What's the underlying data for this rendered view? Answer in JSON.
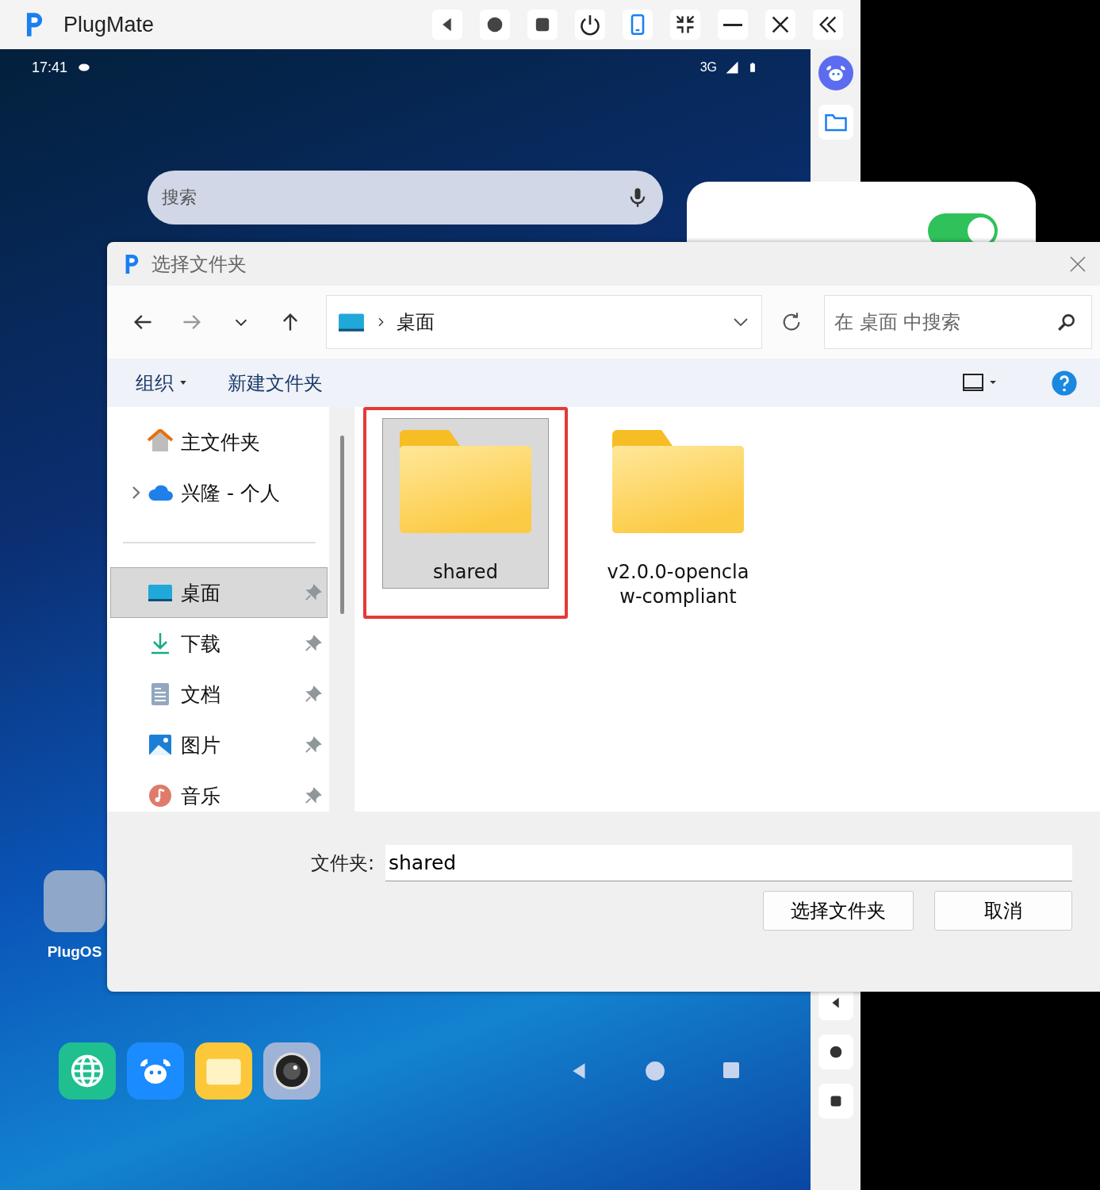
{
  "app": {
    "title": "PlugMate"
  },
  "device": {
    "status_bar": {
      "time": "17:41",
      "network": "3G"
    },
    "search": {
      "placeholder": "搜索"
    },
    "folder": {
      "label": "PlugOS"
    },
    "toggle": {
      "on": true
    }
  },
  "dialog": {
    "title": "选择文件夹",
    "address": {
      "path": "桌面"
    },
    "search": {
      "placeholder": "在 桌面 中搜索"
    },
    "toolbar": {
      "organize": "组织",
      "new_folder": "新建文件夹"
    },
    "sidebar": {
      "items": [
        {
          "label": "主文件夹",
          "kind": "place",
          "selected": false
        },
        {
          "label": "兴隆 - 个人",
          "kind": "tree",
          "expanded": false,
          "selected": false
        },
        {
          "label": "桌面",
          "kind": "pinned",
          "selected": true
        },
        {
          "label": "下载",
          "kind": "pinned",
          "selected": false
        },
        {
          "label": "文档",
          "kind": "pinned",
          "selected": false
        },
        {
          "label": "图片",
          "kind": "pinned",
          "selected": false
        },
        {
          "label": "音乐",
          "kind": "pinned",
          "selected": false
        }
      ]
    },
    "files": [
      {
        "name": "shared",
        "selected": true
      },
      {
        "name": "v2.0.0-openclaw-compliant",
        "selected": false
      }
    ],
    "folder_field": {
      "label": "文件夹:",
      "value": "shared"
    },
    "buttons": [
      "选择文件夹",
      "取消"
    ]
  }
}
